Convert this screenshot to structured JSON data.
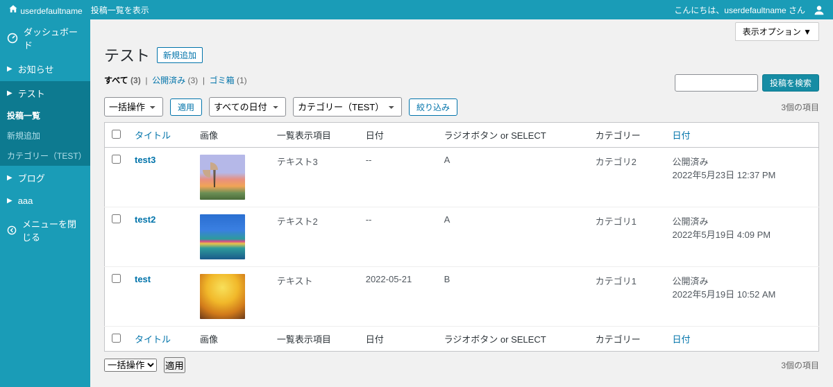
{
  "topbar": {
    "sitename": "userdefaultname",
    "breadcrumb": "投稿一覧を表示",
    "greeting_prefix": "こんにちは、",
    "greeting_user": "userdefaultname",
    "greeting_suffix": " さん"
  },
  "screen_options": "表示オプション ▼",
  "sidebar": {
    "dashboard": "ダッシュボード",
    "notice": "お知らせ",
    "test": "テスト",
    "sub_list": "投稿一覧",
    "sub_add": "新規追加",
    "sub_cat": "カテゴリー（TEST）",
    "blog": "ブログ",
    "aaa": "aaa",
    "collapse": "メニューを閉じる"
  },
  "heading": {
    "title": "テスト",
    "add_new": "新規追加"
  },
  "views": {
    "all_label": "すべて",
    "all_count": "(3)",
    "published_label": "公開済み",
    "published_count": "(3)",
    "trash_label": "ゴミ箱",
    "trash_count": "(1)"
  },
  "filters": {
    "bulk_default": "一括操作",
    "apply": "適用",
    "date_default": "すべての日付",
    "cat_default": "カテゴリー（TEST）",
    "filter": "絞り込み"
  },
  "search": {
    "submit": "投稿を検索"
  },
  "count_label": "3個の項目",
  "columns": {
    "title": "タイトル",
    "image": "画像",
    "list_item": "一覧表示項目",
    "date": "日付",
    "radio": "ラジオボタン or SELECT",
    "category": "カテゴリー",
    "date2": "日付"
  },
  "rows": [
    {
      "title": "test3",
      "list_item": "テキスト3",
      "date": "--",
      "radio": "A",
      "category": "カテゴリ2",
      "status": "公開済み",
      "status_date": "2022年5月23日 12:37 PM",
      "thumb": "thumb-1"
    },
    {
      "title": "test2",
      "list_item": "テキスト2",
      "date": "--",
      "radio": "A",
      "category": "カテゴリ1",
      "status": "公開済み",
      "status_date": "2022年5月19日 4:09 PM",
      "thumb": "thumb-2"
    },
    {
      "title": "test",
      "list_item": "テキスト",
      "date": "2022-05-21",
      "radio": "B",
      "category": "カテゴリ1",
      "status": "公開済み",
      "status_date": "2022年5月19日 10:52 AM",
      "thumb": "thumb-3"
    }
  ]
}
